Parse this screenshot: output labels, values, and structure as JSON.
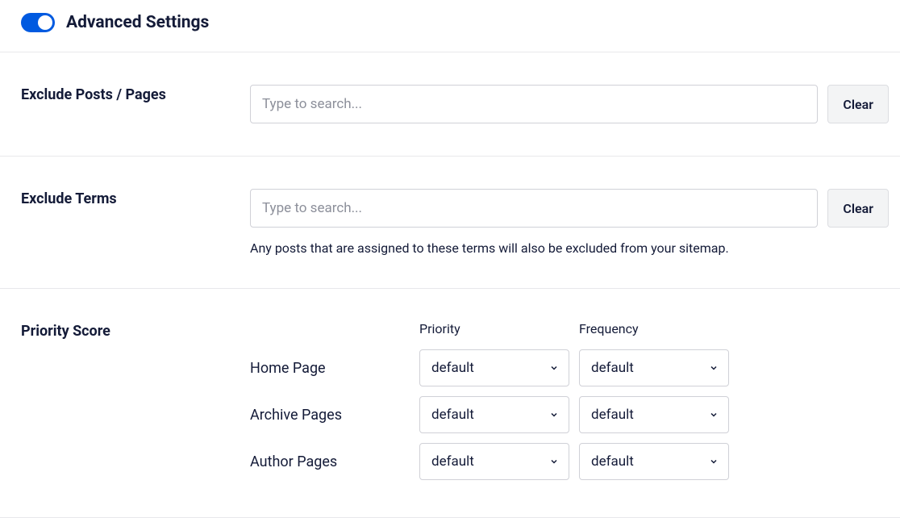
{
  "header": {
    "title": "Advanced Settings",
    "toggle_on": true
  },
  "exclude_posts": {
    "label": "Exclude Posts / Pages",
    "placeholder": "Type to search...",
    "clear_label": "Clear"
  },
  "exclude_terms": {
    "label": "Exclude Terms",
    "placeholder": "Type to search...",
    "clear_label": "Clear",
    "helper": "Any posts that are assigned to these terms will also be excluded from your sitemap."
  },
  "priority": {
    "label": "Priority Score",
    "col_priority": "Priority",
    "col_frequency": "Frequency",
    "rows": [
      {
        "label": "Home Page",
        "priority": "default",
        "frequency": "default"
      },
      {
        "label": "Archive Pages",
        "priority": "default",
        "frequency": "default"
      },
      {
        "label": "Author Pages",
        "priority": "default",
        "frequency": "default"
      }
    ]
  }
}
